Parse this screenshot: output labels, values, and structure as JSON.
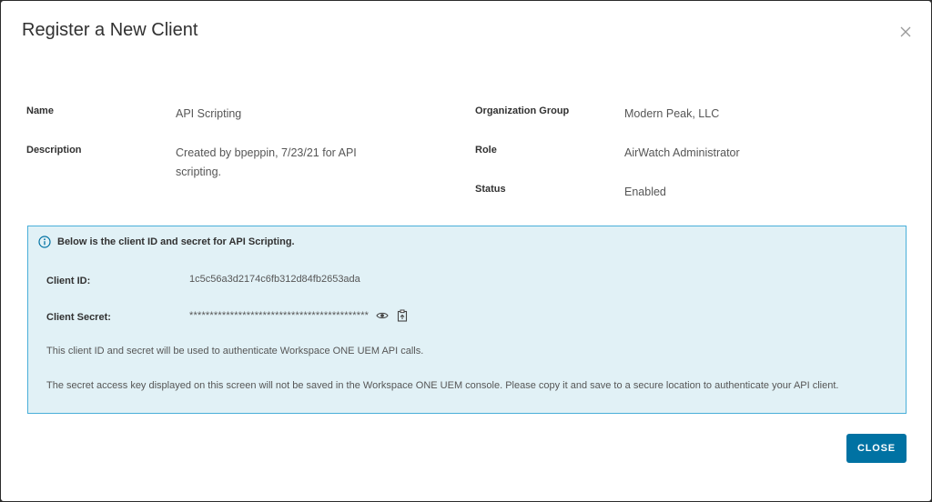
{
  "modal": {
    "title": "Register a New Client"
  },
  "details": {
    "name_label": "Name",
    "name_value": "API Scripting",
    "description_label": "Description",
    "description_value": "Created by bpeppin, 7/23/21 for API scripting.",
    "org_group_label": "Organization Group",
    "org_group_value": "Modern Peak, LLC",
    "role_label": "Role",
    "role_value": "AirWatch Administrator",
    "status_label": "Status",
    "status_value": "Enabled"
  },
  "info_box": {
    "heading": "Below is the client ID and secret for API Scripting.",
    "client_id_label": "Client ID:",
    "client_id_value": "1c5c56a3d2174c6fb312d84fb2653ada",
    "client_secret_label": "Client Secret:",
    "client_secret_mask": "********************************************",
    "note_1": "This client ID and secret will be used to authenticate Workspace ONE UEM API calls.",
    "note_2": "The secret access key displayed on this screen will not be saved in the Workspace ONE UEM console. Please copy it and save to a secure location to authenticate your API client."
  },
  "footer": {
    "close_label": "CLOSE"
  },
  "icons": {
    "dialog_close": "close-icon",
    "info": "info-circle-icon",
    "reveal": "eye-icon",
    "copy": "copy-to-clipboard-icon"
  },
  "colors": {
    "primary_button": "#0072a3",
    "info_background": "#e1f1f6",
    "info_border": "#49afd9",
    "info_icon": "#0072a3"
  }
}
